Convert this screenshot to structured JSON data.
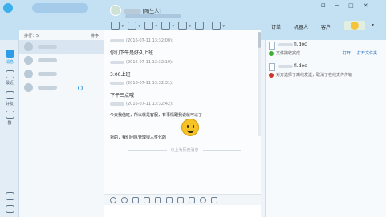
{
  "header": {
    "contact_tag": "[陌生人]",
    "tabs": [
      "订单",
      "机器人",
      "客户"
    ]
  },
  "nav": {
    "items": [
      "消息",
      "最近",
      "好友",
      "群"
    ]
  },
  "list": {
    "sort_label": "排行：5",
    "order_label": "排序"
  },
  "chat": {
    "messages": [
      {
        "meta": "(2016-07-11 13:32:00):",
        "text": "你们下午是好久上班"
      },
      {
        "meta": "(2016-07-11 13:32:19):",
        "text": "3:00上班"
      },
      {
        "meta": "(2016-07-11 13:32:31):",
        "text": "下午三点哦"
      },
      {
        "meta": "(2016-07-11 13:32:42):",
        "text": "今天我值班，所以就是客服，有事情跟我说就可以了"
      }
    ],
    "last_line": "对的，我们团队管理很人性化的",
    "history_label": "以上为历史消息"
  },
  "files": {
    "file1": {
      "ext": "fi.doc",
      "status": "文件接收完成",
      "open": "打开",
      "open_folder": "打开文件夹"
    },
    "file2": {
      "ext": "fi.doc",
      "status": "对方选择了离线发送，取消了在线文件传输"
    }
  },
  "colors": {
    "accent": "#2d9de8",
    "header_bg": "#c4e0f3",
    "success": "#3fae39",
    "error": "#d0342c"
  }
}
